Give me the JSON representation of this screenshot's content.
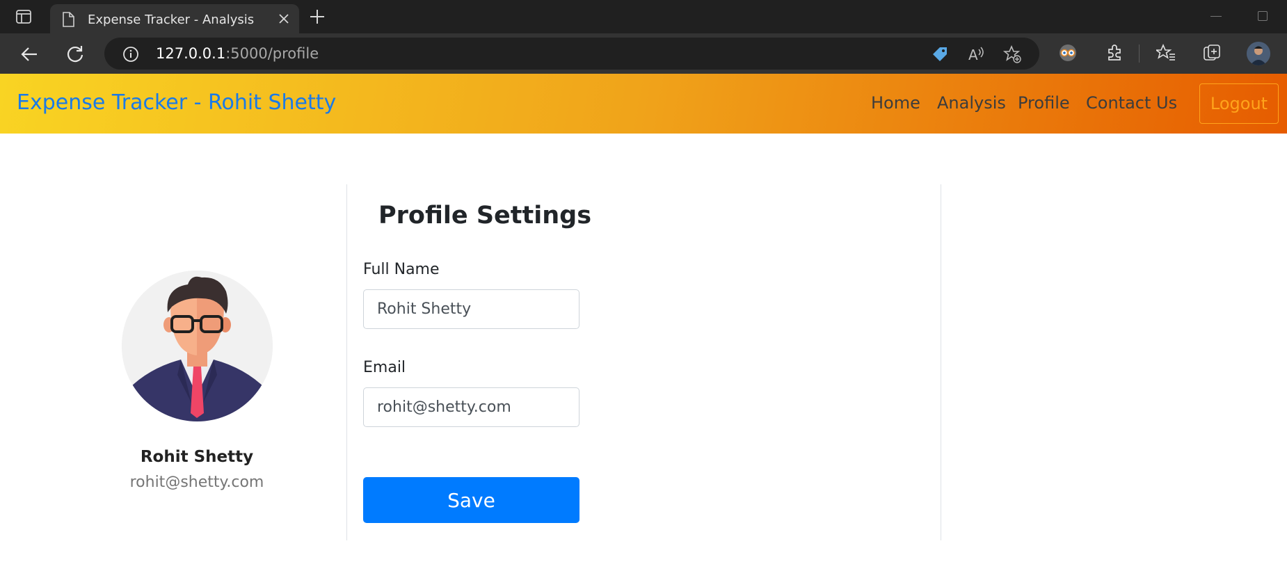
{
  "browser": {
    "tab_title": "Expense Tracker - Analysis",
    "url_host": "127.0.0.1",
    "url_path": ":5000/profile",
    "icons": [
      "sidebar-icon",
      "page-icon",
      "close-icon",
      "new-tab-icon",
      "back-icon",
      "reload-icon",
      "info-icon",
      "tag-icon",
      "read-aloud-icon",
      "add-favorite-icon",
      "extension-glasses-icon",
      "extensions-icon",
      "favorites-icon",
      "collections-icon",
      "profile-avatar"
    ]
  },
  "navbar": {
    "brand": "Expense Tracker - Rohit Shetty",
    "links": [
      "Home",
      "Analysis",
      "Profile",
      "Contact Us"
    ],
    "logout": "Logout"
  },
  "profile_card": {
    "name": "Rohit Shetty",
    "email": "rohit@shetty.com"
  },
  "settings": {
    "title": "Profile Settings",
    "full_name_label": "Full Name",
    "full_name_value": "Rohit Shetty",
    "email_label": "Email",
    "email_value": "rohit@shetty.com",
    "save_label": "Save"
  },
  "colors": {
    "brand_text": "#1a7ae8",
    "navbar_gradient_start": "#f9d423",
    "navbar_gradient_end": "#e65c00",
    "logout_outline": "#ffa41b",
    "primary_button": "#007bff"
  }
}
